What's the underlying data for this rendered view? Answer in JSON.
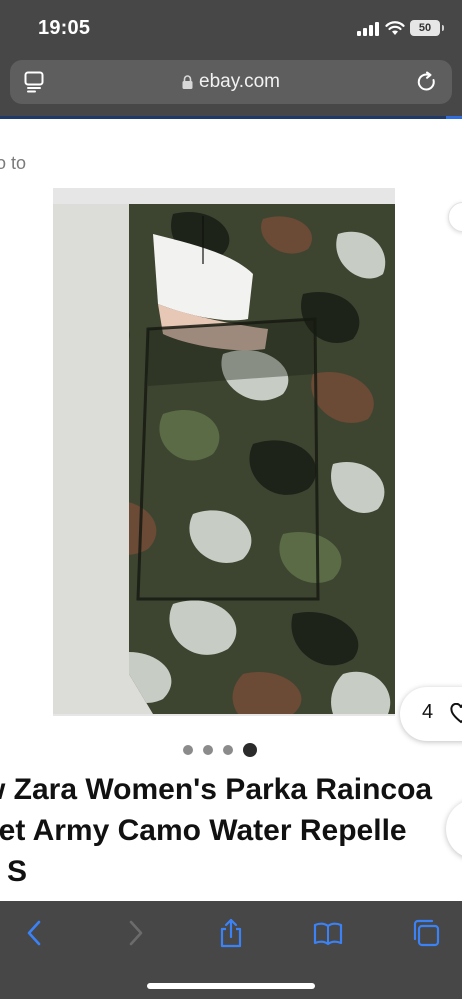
{
  "status_bar": {
    "time": "19:05",
    "battery": "50",
    "icons": [
      "signal-icon",
      "wifi-icon",
      "battery-icon"
    ]
  },
  "url_bar": {
    "domain": "ebay.com",
    "icons": [
      "tabs-overview-icon",
      "lock-icon",
      "reload-icon"
    ]
  },
  "page": {
    "back_text": "o to",
    "watch_count": "4",
    "carousel": {
      "total": 4,
      "active_index": 4
    },
    "title_lines": [
      "w Zara Women's Parka Raincoa",
      "ket Army Camo Water Repelle",
      "e S"
    ]
  },
  "toolbar": {
    "buttons": [
      "back-icon",
      "forward-icon",
      "share-icon",
      "bookmarks-icon",
      "tabs-icon"
    ]
  },
  "colors": {
    "chrome": "#474747",
    "url_bar": "#5e5e5e",
    "accent_blue": "#2f6de1",
    "camo_dark": "#1f2418",
    "camo_olive": "#414a2c"
  }
}
